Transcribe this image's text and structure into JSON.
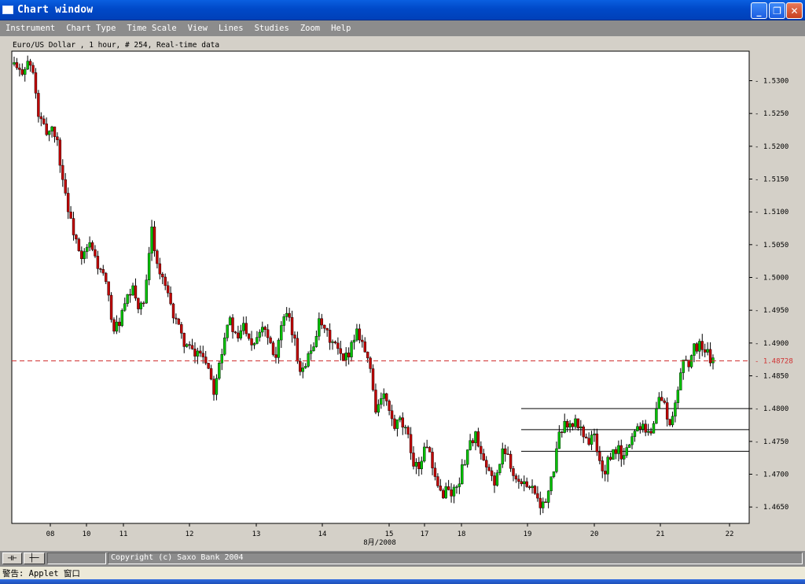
{
  "window": {
    "title": "Chart window",
    "minimize_glyph": "_",
    "maximize_glyph": "❐",
    "close_glyph": "✕"
  },
  "menu": [
    "Instrument",
    "Chart Type",
    "Time Scale",
    "View",
    "Lines",
    "Studies",
    "Zoom",
    "Help"
  ],
  "chart_data": {
    "type": "candlestick",
    "title": "Euro/US Dollar , 1 hour, # 254, Real-time data",
    "xlabel": "8月/2008",
    "ylim": [
      1.4625,
      1.5345
    ],
    "x_ticks": [
      "08",
      "10",
      "11",
      "12",
      "13",
      "14",
      "15",
      "17",
      "18",
      "19",
      "20",
      "21",
      "22"
    ],
    "y_ticks": [
      "1.5300",
      "1.5250",
      "1.5200",
      "1.5150",
      "1.5100",
      "1.5050",
      "1.5000",
      "1.4950",
      "1.4900",
      "1.4850",
      "1.4800",
      "1.4750",
      "1.4700",
      "1.4650"
    ],
    "current_price": "1.48728",
    "current_price_value": 1.48728,
    "horizontal_lines": [
      1.48,
      1.4768,
      1.4735
    ],
    "price_path": [
      1.5325,
      1.531,
      1.532,
      1.533,
      1.531,
      1.525,
      1.523,
      1.522,
      1.523,
      1.521,
      1.516,
      1.512,
      1.508,
      1.506,
      1.502,
      1.504,
      1.505,
      1.503,
      1.501,
      1.5,
      1.496,
      1.492,
      1.493,
      1.495,
      1.497,
      1.498,
      1.496,
      1.495,
      1.5,
      1.508,
      1.502,
      1.5,
      1.498,
      1.495,
      1.494,
      1.491,
      1.49,
      1.489,
      1.488,
      1.489,
      1.488,
      1.486,
      1.483,
      1.487,
      1.49,
      1.494,
      1.492,
      1.49,
      1.493,
      1.492,
      1.49,
      1.491,
      1.493,
      1.492,
      1.49,
      1.488,
      1.492,
      1.494,
      1.493,
      1.49,
      1.486,
      1.487,
      1.488,
      1.49,
      1.493,
      1.492,
      1.491,
      1.49,
      1.489,
      1.487,
      1.488,
      1.49,
      1.492,
      1.491,
      1.488,
      1.486,
      1.48,
      1.481,
      1.482,
      1.479,
      1.477,
      1.478,
      1.477,
      1.475,
      1.472,
      1.471,
      1.473,
      1.475,
      1.47,
      1.468,
      1.467,
      1.468,
      1.467,
      1.468,
      1.47,
      1.473,
      1.475,
      1.476,
      1.473,
      1.471,
      1.47,
      1.469,
      1.471,
      1.474,
      1.473,
      1.47,
      1.469,
      1.468,
      1.469,
      1.468,
      1.467,
      1.465,
      1.466,
      1.469,
      1.473,
      1.477,
      1.478,
      1.477,
      1.478,
      1.477,
      1.476,
      1.475,
      1.476,
      1.472,
      1.47,
      1.472,
      1.473,
      1.474,
      1.472,
      1.474,
      1.476,
      1.477,
      1.478,
      1.477,
      1.476,
      1.48,
      1.482,
      1.48,
      1.477,
      1.48,
      1.485,
      1.488,
      1.487,
      1.489,
      1.49,
      1.489,
      1.488,
      1.4873
    ]
  },
  "statusbar": {
    "button1_glyph": "⊣⊢",
    "button2_glyph": "┼─",
    "copyright": "Copyright (c) Saxo Bank 2004"
  },
  "warning": "警告: Applet 窗口",
  "colors": {
    "up_candle": "#00c000",
    "down_candle": "#c00000",
    "price_line": "#d03030",
    "title_bar": "#0a5fe0"
  }
}
